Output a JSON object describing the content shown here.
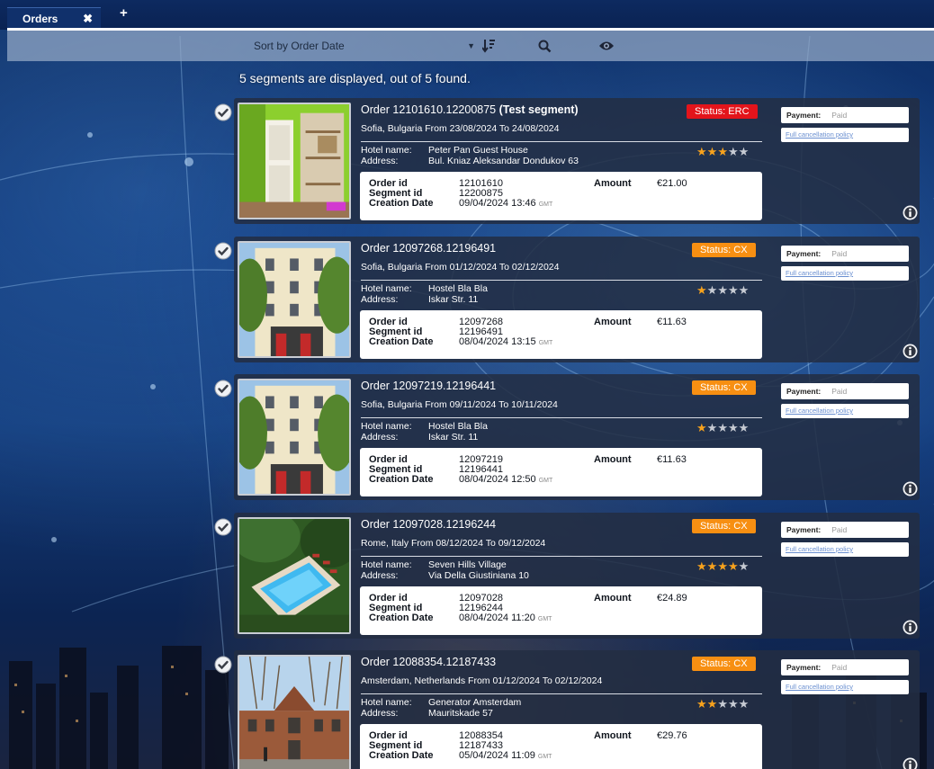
{
  "tabs": {
    "active_label": "Orders",
    "close_glyph": "✖",
    "add_glyph": "+"
  },
  "toolbar": {
    "sort_value": "Sort by Order Date",
    "sort_icon": "sort-descending-icon",
    "search_icon": "search-icon",
    "view_icon": "eye-icon"
  },
  "summary": "5 segments are displayed, out of 5 found.",
  "labels": {
    "hotel_name": "Hotel name:",
    "address": "Address:",
    "order_id": "Order id",
    "segment_id": "Segment id",
    "creation_date": "Creation Date",
    "amount": "Amount",
    "gmt": "GMT",
    "payment": "Payment:",
    "policy": "Full cancellation policy"
  },
  "colors": {
    "status_erc": "#e3141b",
    "status_cx": "#f78f12",
    "star_on": "#f7a21d"
  },
  "orders": [
    {
      "title": "Order 12101610.12200875",
      "title_suffix": " (Test segment)",
      "status": "Status: ERC",
      "status_kind": "erc",
      "location": "Sofia, Bulgaria From 23/08/2024 To 24/08/2024",
      "hotel_name": "Peter Pan Guest House",
      "address": "Bul. Kniaz Aleksandar Dondukov 63",
      "rating": 3,
      "order_id": "12101610",
      "segment_id": "12200875",
      "creation_date": "09/04/2024 13:46",
      "amount": "€21.00",
      "payment": "Paid",
      "image": "room"
    },
    {
      "title": "Order 12097268.12196491",
      "title_suffix": "",
      "status": "Status: CX",
      "status_kind": "cx",
      "location": "Sofia, Bulgaria From 01/12/2024 To 02/12/2024",
      "hotel_name": "Hostel Bla Bla",
      "address": "Iskar Str. 11",
      "rating": 1,
      "order_id": "12097268",
      "segment_id": "12196491",
      "creation_date": "08/04/2024 13:15",
      "amount": "€11.63",
      "payment": "Paid",
      "image": "building"
    },
    {
      "title": "Order 12097219.12196441",
      "title_suffix": "",
      "status": "Status: CX",
      "status_kind": "cx",
      "location": "Sofia, Bulgaria From 09/11/2024 To 10/11/2024",
      "hotel_name": "Hostel Bla Bla",
      "address": "Iskar Str. 11",
      "rating": 1,
      "order_id": "12097219",
      "segment_id": "12196441",
      "creation_date": "08/04/2024 12:50",
      "amount": "€11.63",
      "payment": "Paid",
      "image": "building"
    },
    {
      "title": "Order 12097028.12196244",
      "title_suffix": "",
      "status": "Status: CX",
      "status_kind": "cx",
      "location": "Rome, Italy From 08/12/2024 To 09/12/2024",
      "hotel_name": "Seven Hills Village",
      "address": "Via Della Giustiniana 10",
      "rating": 4,
      "order_id": "12097028",
      "segment_id": "12196244",
      "creation_date": "08/04/2024 11:20",
      "amount": "€24.89",
      "payment": "Paid",
      "image": "pool"
    },
    {
      "title": "Order 12088354.12187433",
      "title_suffix": "",
      "status": "Status: CX",
      "status_kind": "cx",
      "location": "Amsterdam, Netherlands From 01/12/2024 To 02/12/2024",
      "hotel_name": "Generator Amsterdam",
      "address": "Mauritskade 57",
      "rating": 2,
      "order_id": "12088354",
      "segment_id": "12187433",
      "creation_date": "05/04/2024 11:09",
      "amount": "€29.76",
      "payment": "Paid",
      "image": "brick"
    }
  ]
}
